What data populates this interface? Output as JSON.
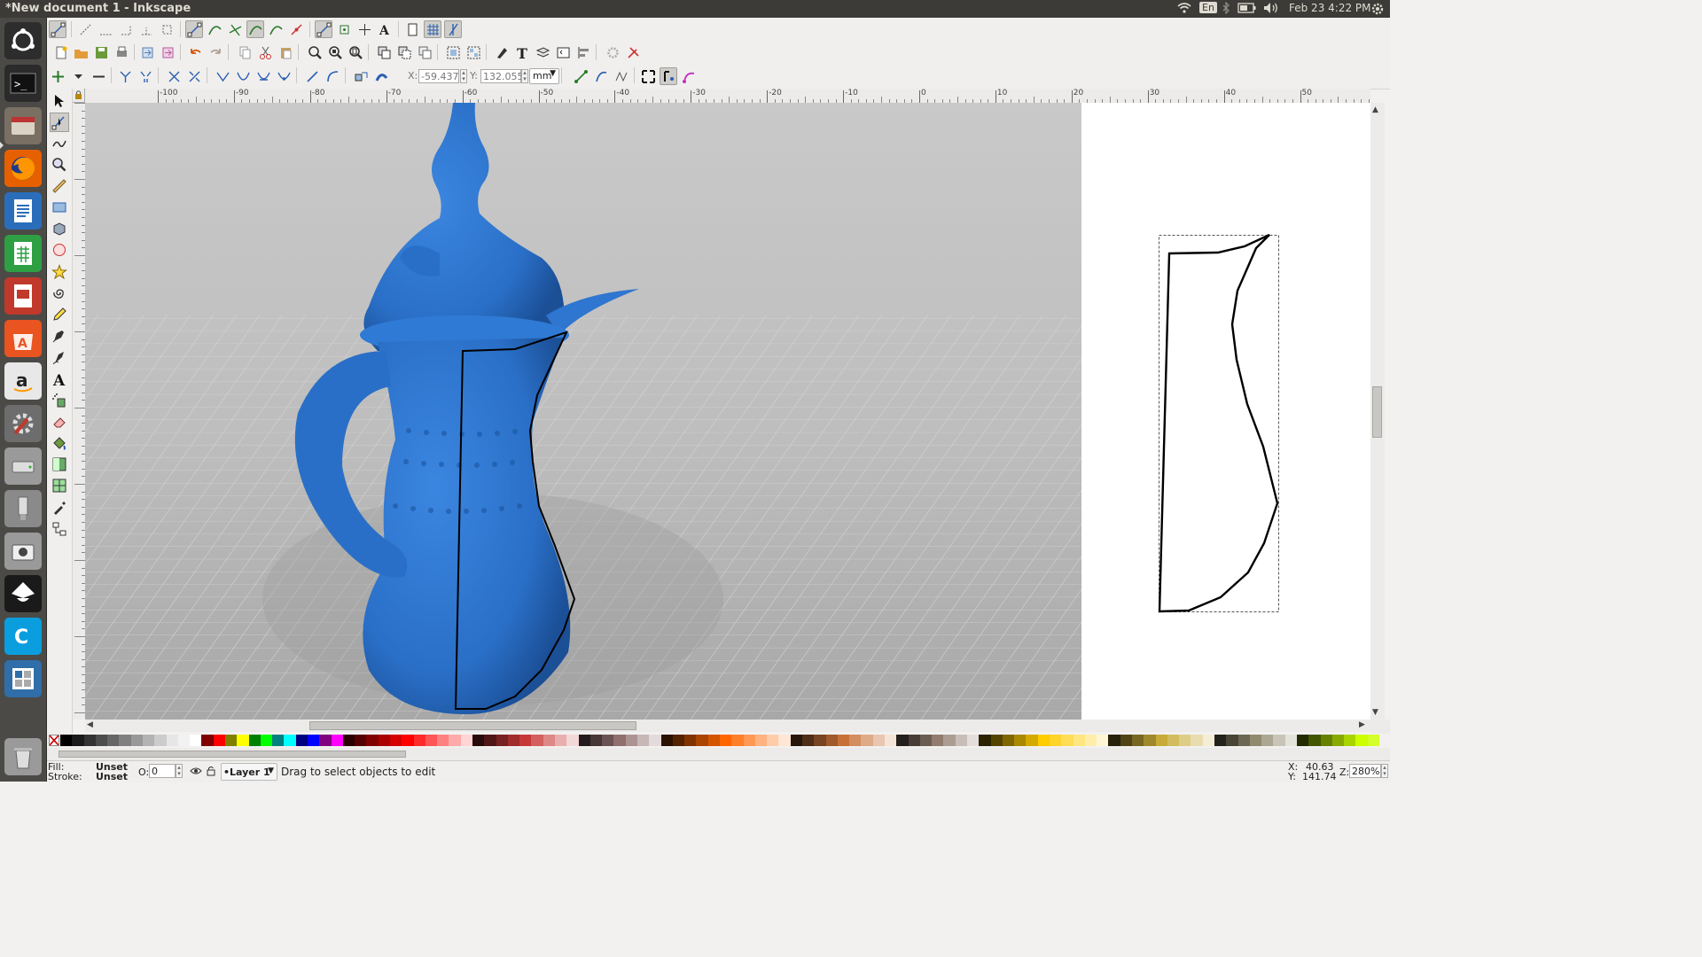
{
  "window": {
    "title": "*New document 1 - Inkscape"
  },
  "system_tray": {
    "keyboard": "En",
    "datetime": "Feb 23  4:22 PM"
  },
  "launcher": {
    "items": [
      {
        "name": "ubuntu-dash-icon",
        "color": "#2d2d2d"
      },
      {
        "name": "terminal-icon",
        "color": "#2b2b2b"
      },
      {
        "name": "files-icon",
        "color": "#7a6f63"
      },
      {
        "name": "firefox-icon",
        "color": "#e66000"
      },
      {
        "name": "libreoffice-writer-icon",
        "color": "#2a6ebb"
      },
      {
        "name": "libreoffice-calc-icon",
        "color": "#2ea043"
      },
      {
        "name": "libreoffice-impress-icon",
        "color": "#c0392b"
      },
      {
        "name": "software-center-icon",
        "color": "#e95420"
      },
      {
        "name": "amazon-icon",
        "color": "#e8e8e8"
      },
      {
        "name": "system-settings-icon",
        "color": "#6d6d6d"
      },
      {
        "name": "disk-icon",
        "color": "#9a9a9a"
      },
      {
        "name": "usb-drive-icon",
        "color": "#8a8a8a"
      },
      {
        "name": "screenshot-camera-icon",
        "color": "#9a9a9a"
      },
      {
        "name": "inkscape-icon",
        "color": "#1a1a1a"
      },
      {
        "name": "cura-icon",
        "color": "#0b9ede"
      },
      {
        "name": "workspace-switcher-icon",
        "color": "#2f6ea8"
      },
      {
        "name": "trash-icon",
        "color": "#9a9a9a"
      }
    ]
  },
  "node_toolbar": {
    "x_label": "X:",
    "x_value": "-59.437",
    "y_label": "Y:",
    "y_value": "132.055",
    "unit": "mm"
  },
  "hruler": {
    "ticks": [
      "-100",
      "-90",
      "-80",
      "-70",
      "-60",
      "-50",
      "-40",
      "-30",
      "-20",
      "-10",
      "0",
      "10",
      "20",
      "30",
      "40",
      "50"
    ]
  },
  "palette": {
    "colors": [
      "#000000",
      "#1a1a1a",
      "#333333",
      "#4d4d4d",
      "#666666",
      "#808080",
      "#999999",
      "#b3b3b3",
      "#cccccc",
      "#e6e6e6",
      "#f2f2f2",
      "#ffffff",
      "#800000",
      "#ff0000",
      "#808000",
      "#ffff00",
      "#008000",
      "#00ff00",
      "#008080",
      "#00ffff",
      "#000080",
      "#0000ff",
      "#800080",
      "#ff00ff",
      "#2b0000",
      "#550000",
      "#800000",
      "#aa0000",
      "#d40000",
      "#ff0000",
      "#ff2a2a",
      "#ff5555",
      "#ff8080",
      "#ffaaaa",
      "#ffd5d5",
      "#280b0b",
      "#501616",
      "#782121",
      "#a02c2c",
      "#c83737",
      "#d35f5f",
      "#de8787",
      "#e9afaf",
      "#f4d7d7",
      "#241c1c",
      "#483737",
      "#6c5353",
      "#916f6f",
      "#ac9393",
      "#c8b7b7",
      "#e3dbdb",
      "#2b1100",
      "#552200",
      "#803300",
      "#aa4400",
      "#d45500",
      "#ff6600",
      "#ff7f2a",
      "#ff9955",
      "#ffb380",
      "#ffccaa",
      "#ffe6d5",
      "#28170b",
      "#502d16",
      "#784421",
      "#a05a2c",
      "#c87137",
      "#d38d5f",
      "#deaa87",
      "#e9c6af",
      "#f4e3d7",
      "#241f1c",
      "#483e37",
      "#6c5d53",
      "#917c6f",
      "#ac9d93",
      "#c8beb7",
      "#e3dedb",
      "#2b2200",
      "#554400",
      "#806600",
      "#aa8800",
      "#d4aa00",
      "#ffcc00",
      "#ffd42a",
      "#ffdd55",
      "#ffe680",
      "#ffeeaa",
      "#fff6d5",
      "#28220b",
      "#504416",
      "#786721",
      "#a0892c",
      "#c8ab37",
      "#d3bc5f",
      "#decd87",
      "#e9ddaf",
      "#f4eed7",
      "#24221c",
      "#484537",
      "#6c6753",
      "#918a6f",
      "#aca793",
      "#c8c4b7",
      "#e3e2db",
      "#222b00",
      "#445500",
      "#668000",
      "#88aa00",
      "#aad400",
      "#ccff00",
      "#d4ff2a"
    ]
  },
  "status": {
    "fill_label": "Fill:",
    "fill_value": "Unset",
    "stroke_label": "Stroke:",
    "stroke_value": "Unset",
    "opacity_label": "O:",
    "opacity_value": "0",
    "layer": "•Layer 1",
    "message": "Drag to select objects to edit",
    "cursor_x_label": "X:",
    "cursor_x": "40.63",
    "cursor_y_label": "Y:",
    "cursor_y": "141.74",
    "zoom_label": "Z:",
    "zoom": "280%"
  },
  "colors": {
    "pot": "#2a6fc7",
    "bg_gray": "#c4c4c4",
    "path": "#000000"
  }
}
